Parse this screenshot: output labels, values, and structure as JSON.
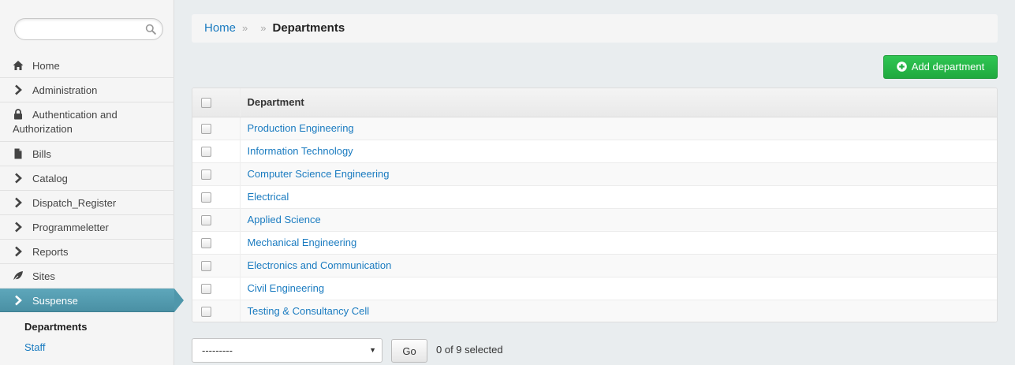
{
  "search": {
    "placeholder": "",
    "value": ""
  },
  "sidebar": {
    "items": [
      {
        "label": "Home",
        "icon": "home-icon"
      },
      {
        "label": "Administration",
        "icon": "chevron-right-icon"
      },
      {
        "label": "Authentication and Authorization",
        "icon": "lock-icon"
      },
      {
        "label": "Bills",
        "icon": "file-icon"
      },
      {
        "label": "Catalog",
        "icon": "chevron-right-icon"
      },
      {
        "label": "Dispatch_Register",
        "icon": "chevron-right-icon"
      },
      {
        "label": "Programmeletter",
        "icon": "chevron-right-icon"
      },
      {
        "label": "Reports",
        "icon": "chevron-right-icon"
      },
      {
        "label": "Sites",
        "icon": "leaf-icon"
      },
      {
        "label": "Suspense",
        "icon": "chevron-right-icon",
        "active": true
      }
    ],
    "subitems": [
      {
        "label": "Departments",
        "current": true
      },
      {
        "label": "Staff",
        "current": false
      }
    ]
  },
  "breadcrumb": {
    "home": "Home",
    "separator": "»",
    "current": "Departments"
  },
  "toolbar": {
    "add_label": "Add department"
  },
  "table": {
    "header": "Department",
    "rows": [
      "Production Engineering",
      "Information Technology",
      "Computer Science Engineering",
      "Electrical",
      "Applied Science",
      "Mechanical Engineering",
      "Electronics and Communication",
      "Civil Engineering",
      "Testing & Consultancy Cell"
    ]
  },
  "actions": {
    "select_value": "---------",
    "go_label": "Go",
    "selected_text": "0 of 9 selected"
  },
  "colors": {
    "accent": "#5197ac",
    "link": "#1a7bc0",
    "add_button": "#27b449"
  }
}
